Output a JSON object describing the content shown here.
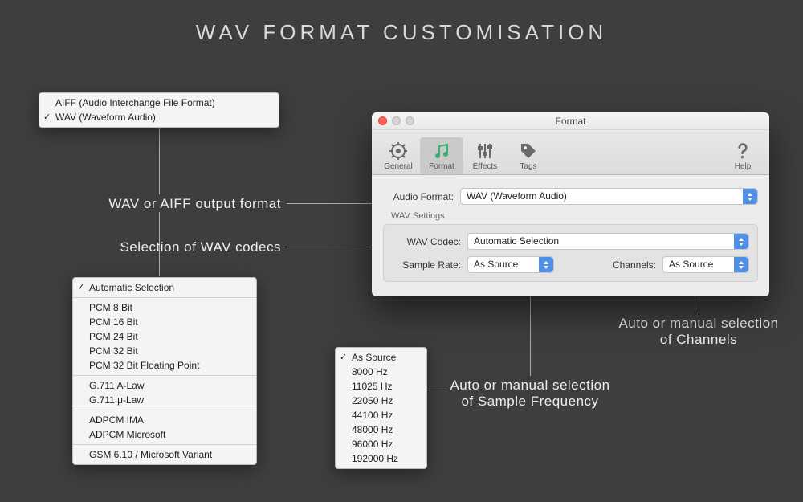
{
  "page_title": "WAV  FORMAT  CUSTOMISATION",
  "annotations": {
    "format": "WAV or AIFF output format",
    "codec": "Selection of WAV codecs",
    "rate": "Auto or manual selection of Sample Frequency",
    "channels": "Auto or manual selection of Channels"
  },
  "format_menu": {
    "items": [
      {
        "label": "AIFF (Audio Interchange File Format)",
        "checked": false
      },
      {
        "label": "WAV (Waveform Audio)",
        "checked": true
      }
    ]
  },
  "codec_menu": {
    "groups": [
      [
        {
          "label": "Automatic Selection",
          "checked": true
        }
      ],
      [
        {
          "label": "PCM 8 Bit"
        },
        {
          "label": "PCM 16 Bit"
        },
        {
          "label": "PCM 24 Bit"
        },
        {
          "label": "PCM 32 Bit"
        },
        {
          "label": "PCM 32 Bit Floating Point"
        }
      ],
      [
        {
          "label": "G.711 A-Law"
        },
        {
          "label": "G.711 μ-Law"
        }
      ],
      [
        {
          "label": "ADPCM IMA"
        },
        {
          "label": "ADPCM Microsoft"
        }
      ],
      [
        {
          "label": "GSM 6.10 / Microsoft Variant"
        }
      ]
    ]
  },
  "rate_menu": {
    "items": [
      {
        "label": "As Source",
        "checked": true
      },
      {
        "label": "8000 Hz"
      },
      {
        "label": "11025 Hz"
      },
      {
        "label": "22050 Hz"
      },
      {
        "label": "44100 Hz"
      },
      {
        "label": "48000 Hz"
      },
      {
        "label": "96000 Hz"
      },
      {
        "label": "192000 Hz"
      }
    ]
  },
  "window": {
    "title": "Format",
    "toolbar": {
      "general": "General",
      "format": "Format",
      "effects": "Effects",
      "tags": "Tags",
      "help": "Help"
    },
    "audio_format_label": "Audio Format:",
    "audio_format_value": "WAV (Waveform Audio)",
    "section_label": "WAV Settings",
    "codec_label": "WAV Codec:",
    "codec_value": "Automatic Selection",
    "rate_label": "Sample Rate:",
    "rate_value": "As Source",
    "channels_label": "Channels:",
    "channels_value": "As Source"
  }
}
